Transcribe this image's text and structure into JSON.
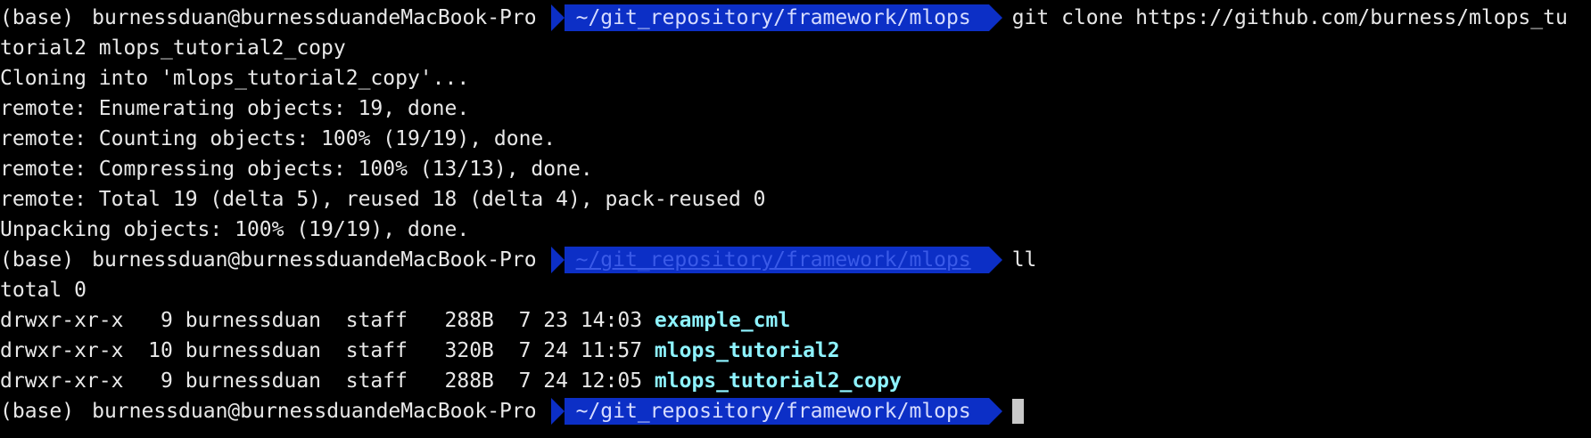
{
  "terminal": {
    "prompt": {
      "conda_env": "(base)",
      "user_host": "burnessduan@burnessduandeMacBook-Pro",
      "path": "~/git_repository/framework/mlops"
    },
    "command1": {
      "line1": "git clone https://github.com/burness/mlops_tu",
      "line2": "torial2 mlops_tutorial2_copy"
    },
    "output1": [
      "Cloning into 'mlops_tutorial2_copy'...",
      "remote: Enumerating objects: 19, done.",
      "remote: Counting objects: 100% (19/19), done.",
      "remote: Compressing objects: 100% (13/13), done.",
      "remote: Total 19 (delta 5), reused 18 (delta 4), pack-reused 0",
      "Unpacking objects: 100% (19/19), done."
    ],
    "command2": "ll",
    "total": "total 0",
    "listing": [
      {
        "meta": "drwxr-xr-x   9 burnessduan  staff   288B  7 23 14:03 ",
        "name": "example_cml"
      },
      {
        "meta": "drwxr-xr-x  10 burnessduan  staff   320B  7 24 11:57 ",
        "name": "mlops_tutorial2"
      },
      {
        "meta": "drwxr-xr-x   9 burnessduan  staff   288B  7 24 12:05 ",
        "name": "mlops_tutorial2_copy"
      }
    ],
    "colors": {
      "background": "#000000",
      "text": "#e8e8e8",
      "path_segment_bg": "#0c2fc6",
      "directory": "#8ef3ff"
    }
  }
}
